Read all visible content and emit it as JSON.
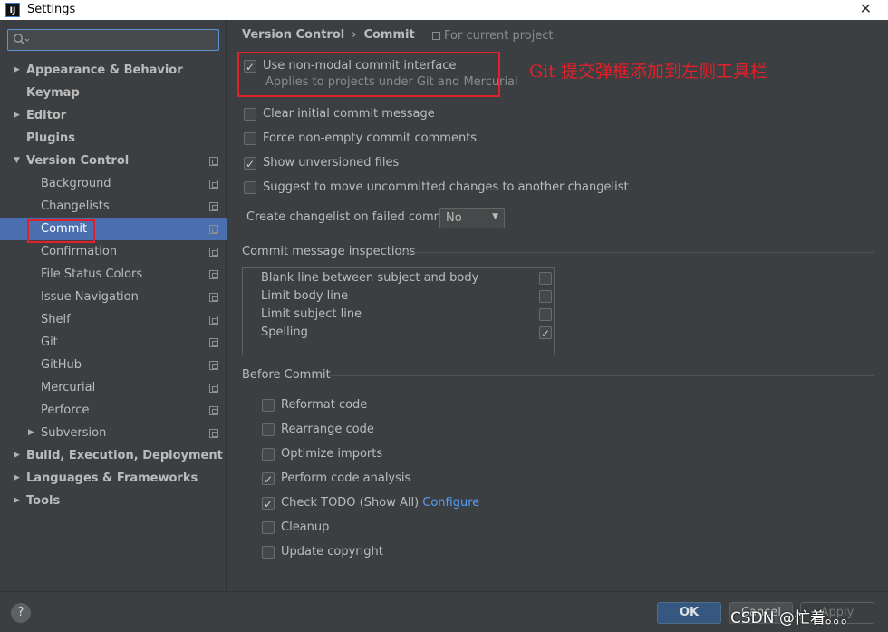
{
  "window": {
    "title": "Settings",
    "app_icon": "IJ"
  },
  "search": {
    "value": "",
    "placeholder": ""
  },
  "tree": [
    {
      "label": "Appearance & Behavior",
      "arrow": "▶",
      "bold": true
    },
    {
      "label": "Keymap",
      "bold": true
    },
    {
      "label": "Editor",
      "arrow": "▶",
      "bold": true
    },
    {
      "label": "Plugins",
      "bold": true
    },
    {
      "label": "Version Control",
      "arrow": "▼",
      "bold": true
    },
    {
      "label": "Background"
    },
    {
      "label": "Changelists"
    },
    {
      "label": "Commit",
      "selected": true
    },
    {
      "label": "Confirmation"
    },
    {
      "label": "File Status Colors"
    },
    {
      "label": "Issue Navigation"
    },
    {
      "label": "Shelf"
    },
    {
      "label": "Git"
    },
    {
      "label": "GitHub"
    },
    {
      "label": "Mercurial"
    },
    {
      "label": "Perforce"
    },
    {
      "label": "Subversion",
      "arrow": "▶"
    },
    {
      "label": "Build, Execution, Deployment",
      "arrow": "▶",
      "bold": true
    },
    {
      "label": "Languages & Frameworks",
      "arrow": "▶",
      "bold": true
    },
    {
      "label": "Tools",
      "arrow": "▶",
      "bold": true
    }
  ],
  "breadcrumb": {
    "parent": "Version Control",
    "separator": "›",
    "current": "Commit",
    "scope": "For current project"
  },
  "annotation": "Git 提交弹框添加到左侧工具栏",
  "options": [
    {
      "label": "Use non-modal commit interface",
      "checked": true,
      "sub": "Applies to projects under Git and Mercurial"
    },
    {
      "label": "Clear initial commit message",
      "checked": false
    },
    {
      "label": "Force non-empty commit comments",
      "checked": false
    },
    {
      "label": "Show unversioned files",
      "checked": true
    },
    {
      "label": "Suggest to move uncommitted changes to another changelist",
      "checked": false
    }
  ],
  "changelist_combo": {
    "label": "Create changelist on failed commit:",
    "value": "No"
  },
  "inspections": {
    "title": "Commit message inspections",
    "items": [
      {
        "label": "Blank line between subject and body",
        "checked": false
      },
      {
        "label": "Limit body line",
        "checked": false
      },
      {
        "label": "Limit subject line",
        "checked": false
      },
      {
        "label": "Spelling",
        "checked": true
      }
    ]
  },
  "before_commit": {
    "title": "Before Commit",
    "items": [
      {
        "label": "Reformat code",
        "checked": false
      },
      {
        "label": "Rearrange code",
        "checked": false
      },
      {
        "label": "Optimize imports",
        "checked": false
      },
      {
        "label": "Perform code analysis",
        "checked": true
      },
      {
        "label": "Check TODO (Show All)",
        "checked": true,
        "link": "Configure"
      },
      {
        "label": "Cleanup",
        "checked": false
      },
      {
        "label": "Update copyright",
        "checked": false
      }
    ]
  },
  "buttons": {
    "help": "?",
    "ok": "OK",
    "cancel": "Cancel",
    "apply": "Apply"
  },
  "watermark": "CSDN @忙着。。。",
  "colors": {
    "background": "#3c3f41",
    "selection": "#4b6eaf",
    "annotation": "#e0202a",
    "link": "#589df6"
  }
}
